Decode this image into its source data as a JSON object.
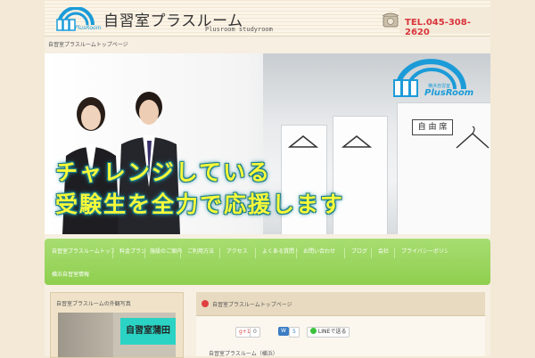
{
  "header": {
    "site_title": "自習室プラスルーム",
    "site_subtitle": "Plusroom studyroom",
    "logo_text": "PlusRoom",
    "tel": "TEL.045-308-2620",
    "breadcrumb": "自習室プラスルームトップページ"
  },
  "hero": {
    "line1": "チャレンジしている",
    "line2": "受験生を全力で応援します",
    "seat_sign": "自 由 席",
    "logo_small": "横浜自習室",
    "logo_text": "PlusRoom"
  },
  "nav": {
    "items": [
      "自習室プラスルームトップページ",
      "料金プラン",
      "施設のご案内",
      "ご利用方法",
      "アクセス",
      "よくある質問・Q&A",
      "お問い合わせ",
      "ブログ",
      "会社",
      "プライバシーポリシー",
      "横浜自習室情報"
    ]
  },
  "sidebar": {
    "title": "自習室プラスルームの外観写真",
    "sign_text": "自習室蒲田"
  },
  "main": {
    "title": "自習室プラスルームトップページ",
    "share": {
      "gplus_label": "g+1",
      "gplus_count": "0",
      "hatena_label": "W",
      "hatena_count": "5",
      "line_label": "LINEで送る"
    },
    "foot_text": "自習室プラスルーム（横浜）"
  },
  "colors": {
    "tel": "#d8343b",
    "nav": "#96d35a",
    "hero_text": "#f7f93a",
    "hero_text_outline": "#1b7d8a",
    "sign": "#2bd3c4"
  }
}
